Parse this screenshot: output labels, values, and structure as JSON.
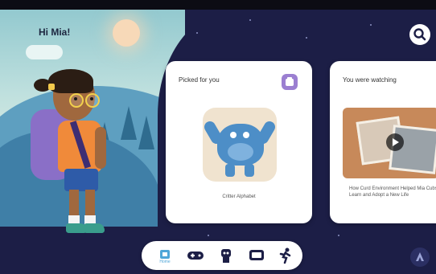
{
  "header": {
    "greeting": "Hi Mia!"
  },
  "cards": {
    "picked": {
      "title": "Picked for you",
      "caption": "Critter Alphabet"
    },
    "watching": {
      "title": "You were watching",
      "caption": "How Curd Environment Helped Mia Cubs Learn and Adopt a New Life"
    }
  },
  "nav": {
    "items": [
      {
        "label": "Home",
        "icon": "home-icon",
        "active": true
      },
      {
        "label": "",
        "icon": "gamepad-icon",
        "active": false
      },
      {
        "label": "",
        "icon": "robot-icon",
        "active": false
      },
      {
        "label": "",
        "icon": "tv-icon",
        "active": false
      },
      {
        "label": "",
        "icon": "run-icon",
        "active": false
      }
    ]
  },
  "colors": {
    "background": "#1c1e46",
    "accent": "#4fa6d8",
    "badge": "#9b7fd1",
    "card": "#ffffff"
  },
  "icons": {
    "search": "search-icon",
    "account": "account-icon",
    "badge": "collection-icon"
  }
}
